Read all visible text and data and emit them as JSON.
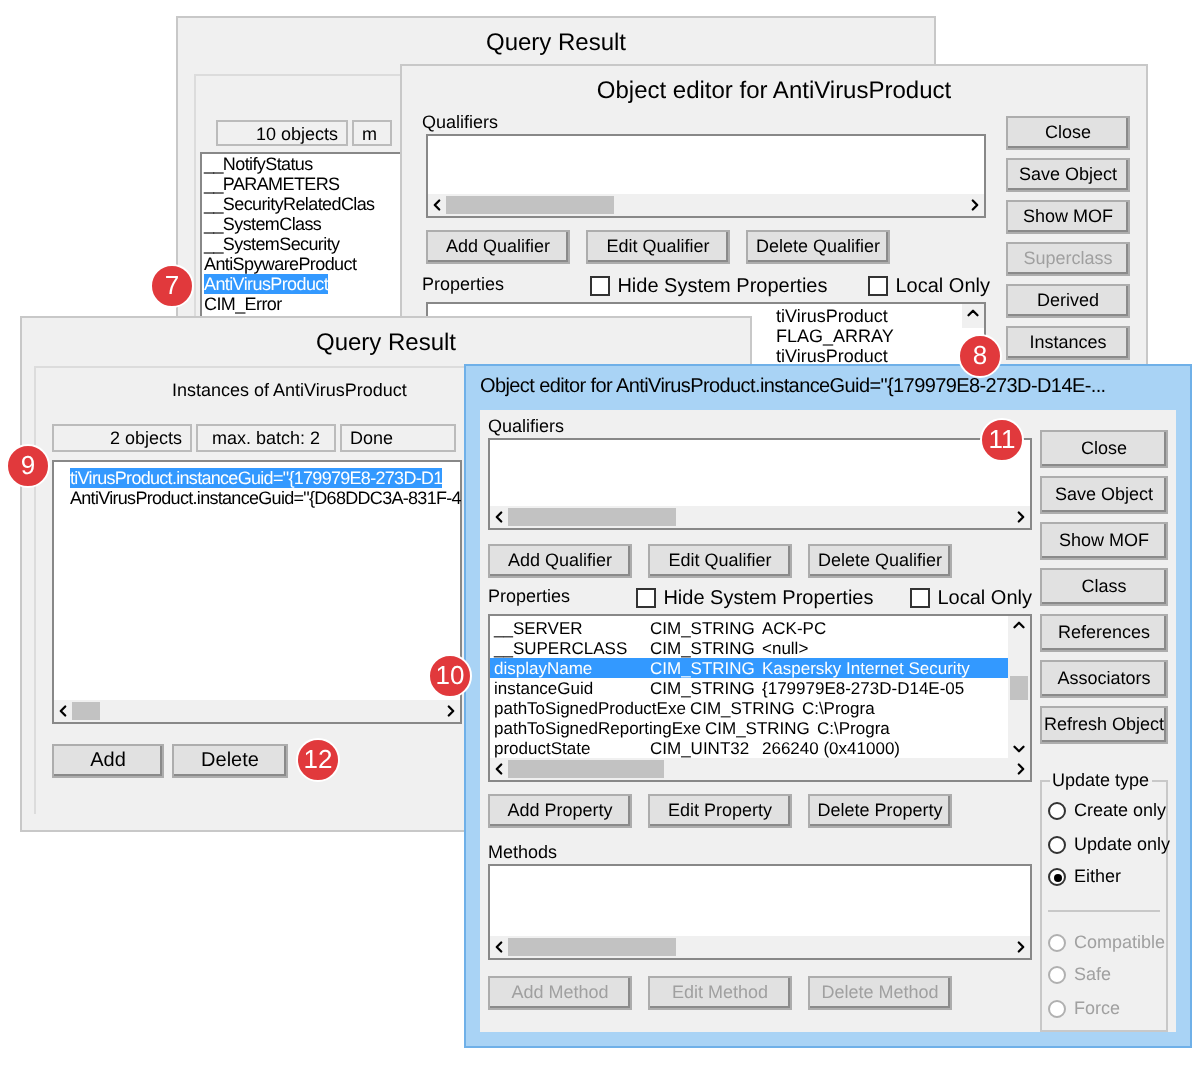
{
  "class_query_result": {
    "title": "Query Result",
    "status": [
      "10 objects",
      "m"
    ],
    "classes": [
      {
        "name": "__NotifyStatus",
        "selected": false
      },
      {
        "name": "__PARAMETERS",
        "selected": false
      },
      {
        "name": "__SecurityRelatedClas",
        "selected": false
      },
      {
        "name": "__SystemClass",
        "selected": false
      },
      {
        "name": "__SystemSecurity",
        "selected": false
      },
      {
        "name": "AntiSpywareProduct",
        "selected": false
      },
      {
        "name": "AntiVirusProduct",
        "selected": true
      },
      {
        "name": "CIM_Error",
        "selected": false
      }
    ]
  },
  "class_editor": {
    "title": "Object editor for AntiVirusProduct",
    "qualifiers_label": "Qualifiers",
    "qualifier_buttons": [
      {
        "label": "Add Qualifier",
        "disabled": false
      },
      {
        "label": "Edit Qualifier",
        "disabled": false
      },
      {
        "label": "Delete Qualifier",
        "disabled": false
      }
    ],
    "properties_label": "Properties",
    "options": [
      {
        "label": "Hide System Properties",
        "checked": false
      },
      {
        "label": "Local Only",
        "checked": false
      }
    ],
    "properties": [
      "tiVirusProduct",
      "FLAG_ARRAY",
      "tiVirusProduct"
    ],
    "side_buttons": [
      {
        "label": "Close",
        "disabled": false
      },
      {
        "label": "Save Object",
        "disabled": false
      },
      {
        "label": "Show MOF",
        "disabled": false
      },
      {
        "label": "Superclass",
        "disabled": true
      },
      {
        "label": "Derived",
        "disabled": false
      },
      {
        "label": "Instances",
        "disabled": false
      }
    ]
  },
  "instance_query_result": {
    "title": "Query Result",
    "caption": "Instances of AntiVirusProduct",
    "status": [
      "2 objects",
      "max. batch: 2",
      "Done"
    ],
    "instances": [
      {
        "text": "tiVirusProduct.instanceGuid=\"{179979E8-273D-D1",
        "selected": true
      },
      {
        "text": "AntiVirusProduct.instanceGuid=\"{D68DDC3A-831F-4",
        "selected": false
      }
    ],
    "buttons": [
      "Add",
      "Delete"
    ]
  },
  "instance_editor": {
    "title": "Object editor for AntiVirusProduct.instanceGuid=\"{179979E8-273D-D14E-...",
    "qualifiers_label": "Qualifiers",
    "qualifier_buttons": [
      {
        "label": "Add Qualifier",
        "disabled": false
      },
      {
        "label": "Edit Qualifier",
        "disabled": false
      },
      {
        "label": "Delete Qualifier",
        "disabled": false
      }
    ],
    "properties_label": "Properties",
    "options": [
      {
        "label": "Hide System Properties",
        "checked": false
      },
      {
        "label": "Local Only",
        "checked": false
      }
    ],
    "properties": [
      {
        "name": "__SERVER",
        "type": "CIM_STRING",
        "value": "ACK-PC",
        "selected": false
      },
      {
        "name": "__SUPERCLASS",
        "type": "CIM_STRING",
        "value": "<null>",
        "selected": false
      },
      {
        "name": "displayName",
        "type": "CIM_STRING",
        "value": "Kaspersky Internet Security",
        "selected": true
      },
      {
        "name": "instanceGuid",
        "type": "CIM_STRING",
        "value": "{179979E8-273D-D14E-05",
        "selected": false
      },
      {
        "name": "pathToSignedProductExe",
        "type": "CIM_STRING",
        "value": "C:\\Progra",
        "selected": false
      },
      {
        "name": "pathToSignedReportingExe",
        "type": "CIM_STRING",
        "value": "C:\\Progra",
        "selected": false
      },
      {
        "name": "productState",
        "type": "CIM_UINT32",
        "value": "266240 (0x41000)",
        "selected": false
      }
    ],
    "property_buttons": [
      {
        "label": "Add Property",
        "disabled": false
      },
      {
        "label": "Edit Property",
        "disabled": false
      },
      {
        "label": "Delete Property",
        "disabled": false
      }
    ],
    "methods_label": "Methods",
    "method_buttons": [
      {
        "label": "Add Method",
        "disabled": true
      },
      {
        "label": "Edit Method",
        "disabled": true
      },
      {
        "label": "Delete Method",
        "disabled": true
      }
    ],
    "side_buttons": [
      {
        "label": "Close",
        "disabled": false
      },
      {
        "label": "Save Object",
        "disabled": false
      },
      {
        "label": "Show MOF",
        "disabled": false
      },
      {
        "label": "Class",
        "disabled": false
      },
      {
        "label": "References",
        "disabled": false
      },
      {
        "label": "Associators",
        "disabled": false
      },
      {
        "label": "Refresh Object",
        "disabled": false
      }
    ],
    "update_type": {
      "label": "Update type",
      "options": [
        {
          "label": "Create only",
          "selected": false,
          "disabled": false
        },
        {
          "label": "Update only",
          "selected": false,
          "disabled": false
        },
        {
          "label": "Either",
          "selected": true,
          "disabled": false
        },
        {
          "label": "Compatible",
          "selected": false,
          "disabled": true
        },
        {
          "label": "Safe",
          "selected": false,
          "disabled": true
        },
        {
          "label": "Force",
          "selected": false,
          "disabled": true
        }
      ]
    }
  },
  "callouts": [
    "7",
    "8",
    "9",
    "10",
    "11",
    "12"
  ]
}
